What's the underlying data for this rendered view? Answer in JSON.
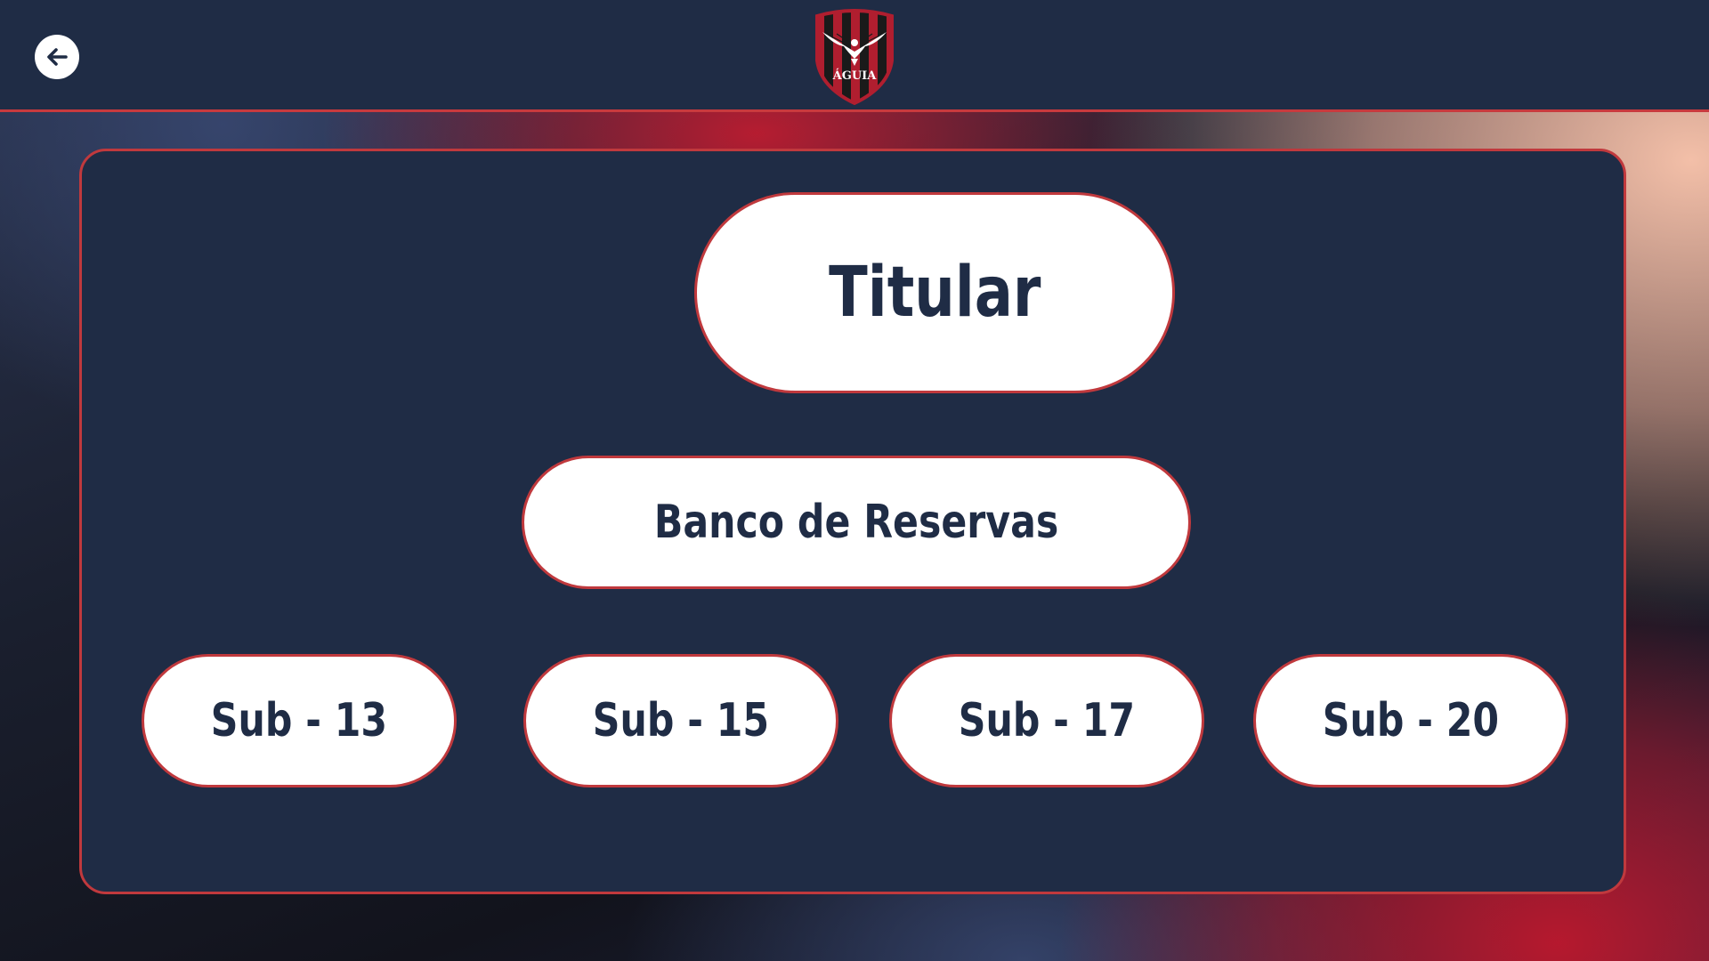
{
  "header": {
    "back_icon": "arrow-left-icon",
    "logo": {
      "text": "ÁGUIA",
      "icon": "eagle-crest-icon",
      "colors": {
        "red": "#b01e2f",
        "black": "#1a1a1a",
        "white": "#ffffff"
      }
    }
  },
  "main": {
    "titular_label": "Titular",
    "banco_label": "Banco de Reservas",
    "categories": [
      {
        "label": "Sub - 13"
      },
      {
        "label": "Sub - 15"
      },
      {
        "label": "Sub - 17"
      },
      {
        "label": "Sub - 20"
      }
    ]
  },
  "colors": {
    "navy": "#1f2c45",
    "accent_red": "#c0393d",
    "white": "#ffffff",
    "peach": "#ffc8af"
  }
}
